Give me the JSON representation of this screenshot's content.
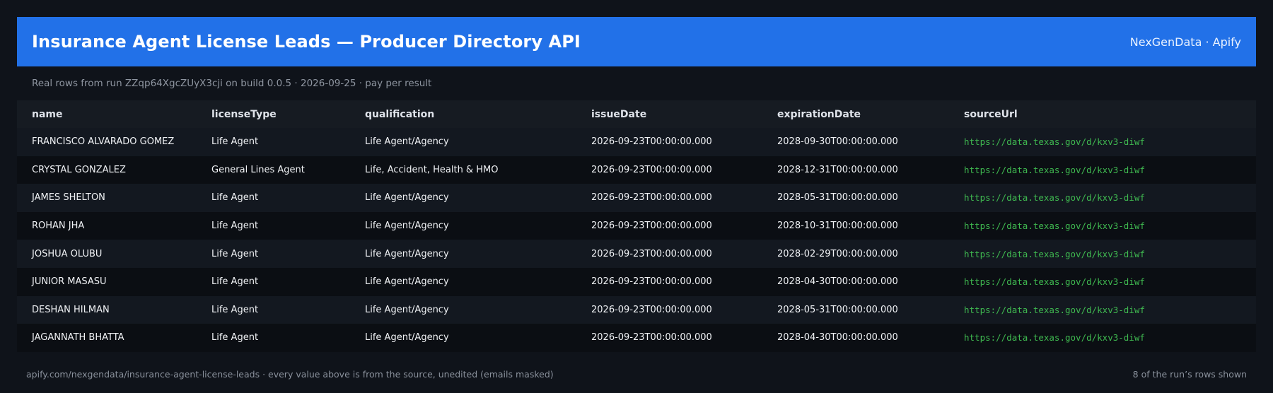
{
  "header": {
    "title": "Insurance Agent License Leads — Producer Directory API",
    "brand": "NexGenData · Apify"
  },
  "subtitle": "Real rows from run ZZqp64XgcZUyX3cji on build 0.0.5 · 2026-09-25 · pay per result",
  "table": {
    "columns": [
      "name",
      "licenseType",
      "qualification",
      "issueDate",
      "expirationDate",
      "sourceUrl"
    ],
    "rows": [
      [
        "FRANCISCO ALVARADO GOMEZ",
        "Life Agent",
        "Life Agent/Agency",
        "2026-09-23T00:00:00.000",
        "2028-09-30T00:00:00.000",
        "https://data.texas.gov/d/kxv3-diwf"
      ],
      [
        "CRYSTAL GONZALEZ",
        "General Lines Agent",
        "Life, Accident, Health & HMO",
        "2026-09-23T00:00:00.000",
        "2028-12-31T00:00:00.000",
        "https://data.texas.gov/d/kxv3-diwf"
      ],
      [
        "JAMES SHELTON",
        "Life Agent",
        "Life Agent/Agency",
        "2026-09-23T00:00:00.000",
        "2028-05-31T00:00:00.000",
        "https://data.texas.gov/d/kxv3-diwf"
      ],
      [
        "ROHAN JHA",
        "Life Agent",
        "Life Agent/Agency",
        "2026-09-23T00:00:00.000",
        "2028-10-31T00:00:00.000",
        "https://data.texas.gov/d/kxv3-diwf"
      ],
      [
        "JOSHUA OLUBU",
        "Life Agent",
        "Life Agent/Agency",
        "2026-09-23T00:00:00.000",
        "2028-02-29T00:00:00.000",
        "https://data.texas.gov/d/kxv3-diwf"
      ],
      [
        "JUNIOR MASASU",
        "Life Agent",
        "Life Agent/Agency",
        "2026-09-23T00:00:00.000",
        "2028-04-30T00:00:00.000",
        "https://data.texas.gov/d/kxv3-diwf"
      ],
      [
        "DESHAN HILMAN",
        "Life Agent",
        "Life Agent/Agency",
        "2026-09-23T00:00:00.000",
        "2028-05-31T00:00:00.000",
        "https://data.texas.gov/d/kxv3-diwf"
      ],
      [
        "JAGANNATH BHATTA",
        "Life Agent",
        "Life Agent/Agency",
        "2026-09-23T00:00:00.000",
        "2028-04-30T00:00:00.000",
        "https://data.texas.gov/d/kxv3-diwf"
      ]
    ]
  },
  "footer": {
    "left": "apify.com/nexgendata/insurance-agent-license-leads  ·  every value above is from the source, unedited (emails masked)",
    "right": "8 of the run’s rows shown"
  },
  "colors": {
    "header_bg": "#2271e8",
    "page_bg": "#0f131a",
    "url_green": "#3fb950"
  }
}
